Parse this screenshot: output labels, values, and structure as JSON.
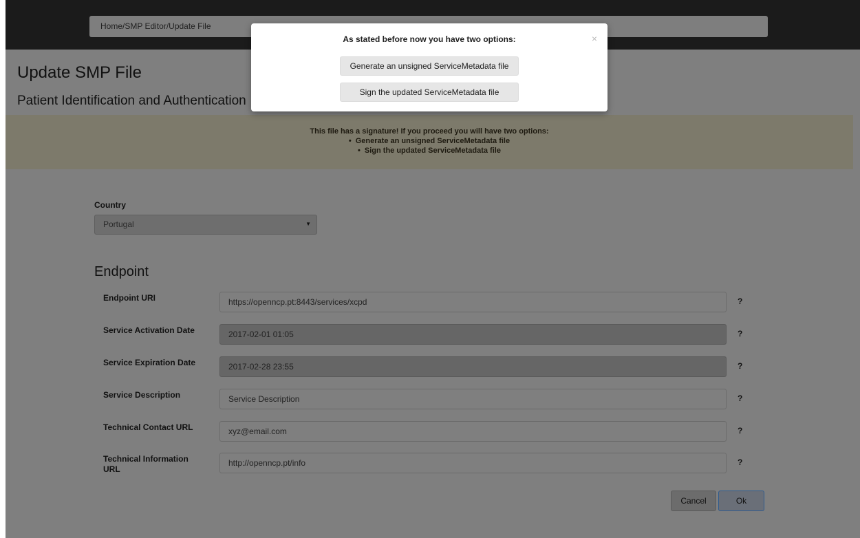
{
  "breadcrumb": "Home/SMP Editor/Update File",
  "page_title": "Update SMP File",
  "page_subtitle": "Patient Identification and Authentication",
  "alert": {
    "message": "This file has a signature! If you proceed you will have two options:",
    "options": [
      "Generate an unsigned ServiceMetadata file",
      "Sign the updated ServiceMetadata file"
    ]
  },
  "country": {
    "label": "Country",
    "value": "Portugal"
  },
  "endpoint": {
    "title": "Endpoint",
    "fields": [
      {
        "label": "Endpoint URI",
        "value": "https://openncp.pt:8443/services/xcpd",
        "help": "?"
      },
      {
        "label": "Service Activation Date",
        "value": "2017-02-01 01:05",
        "help": "?"
      },
      {
        "label": "Service Expiration Date",
        "value": "2017-02-28 23:55",
        "help": "?"
      },
      {
        "label": "Service Description",
        "value": "Service Description",
        "help": "?"
      },
      {
        "label": "Technical Contact URL",
        "value": "xyz@email.com",
        "help": "?"
      },
      {
        "label": "Technical Information URL",
        "value": "http://openncp.pt/info",
        "help": "?"
      }
    ]
  },
  "buttons": {
    "cancel": "Cancel",
    "ok": "Ok"
  },
  "modal": {
    "title": "As stated before now you have two options:",
    "close": "×",
    "option1": "Generate an unsigned ServiceMetadata file",
    "option2": "Sign the updated ServiceMetadata file"
  }
}
